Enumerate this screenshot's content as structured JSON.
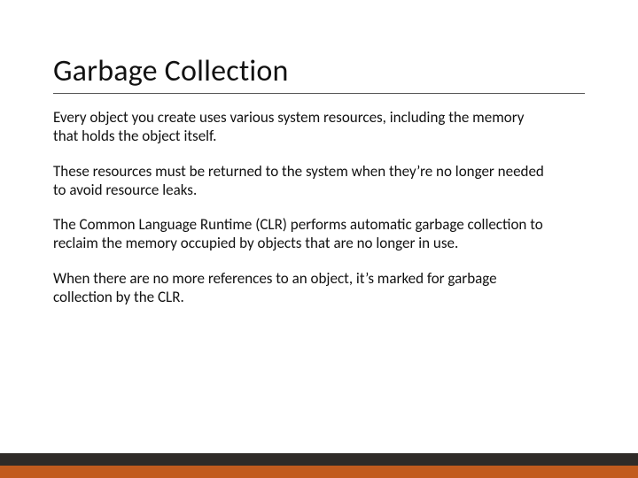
{
  "slide": {
    "title": "Garbage Collection",
    "paragraphs": [
      "Every object you create uses various system resources, including the memory that holds the object itself.",
      "These resources must be returned to the system when they’re no longer needed to avoid resource leaks.",
      "The Common Language Runtime (CLR) performs automatic garbage collection to reclaim the memory occupied by objects that are no longer in use.",
      "When there are no more references to an object, it’s marked for garbage collection by the CLR."
    ]
  },
  "theme": {
    "accent_dark": "#2f2b28",
    "accent_orange": "#c25b1e"
  }
}
